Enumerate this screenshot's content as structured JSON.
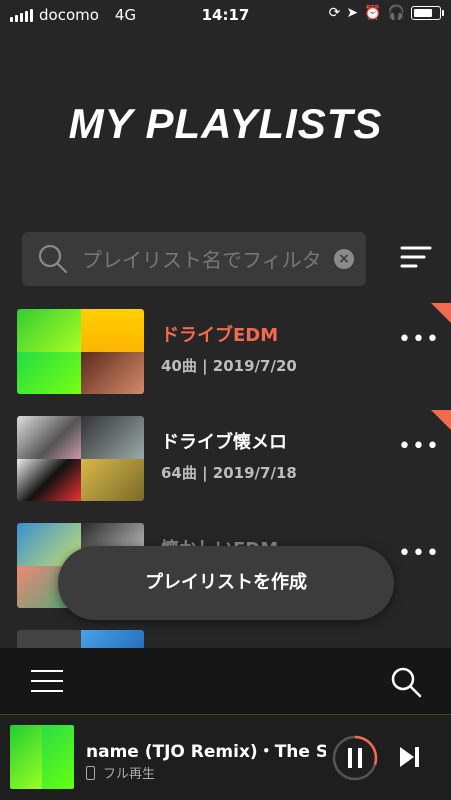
{
  "status": {
    "carrier": "docomo",
    "network": "4G",
    "time": "14:17"
  },
  "header": {
    "title": "MY PLAYLISTS"
  },
  "search": {
    "placeholder": "プレイリスト名でフィルタ"
  },
  "playlists": [
    {
      "name": "ドライブEDM",
      "meta": "40曲 | 2019/7/20",
      "name_color": "#f26a4f",
      "flagged": true
    },
    {
      "name": "ドライブ懐メロ",
      "meta": "64曲 | 2019/7/18",
      "name_color": "#ffffff",
      "flagged": true
    },
    {
      "name": "懐かしいEDM",
      "meta": "",
      "name_color": "#ffffff",
      "flagged": false
    }
  ],
  "toast": {
    "label": "プレイリストを作成"
  },
  "player": {
    "track": "name (TJO Remix)・The Sp",
    "sub": "フル再生",
    "progress": 0.3
  },
  "colors": {
    "accent": "#f26a4f",
    "background": "#262626"
  }
}
